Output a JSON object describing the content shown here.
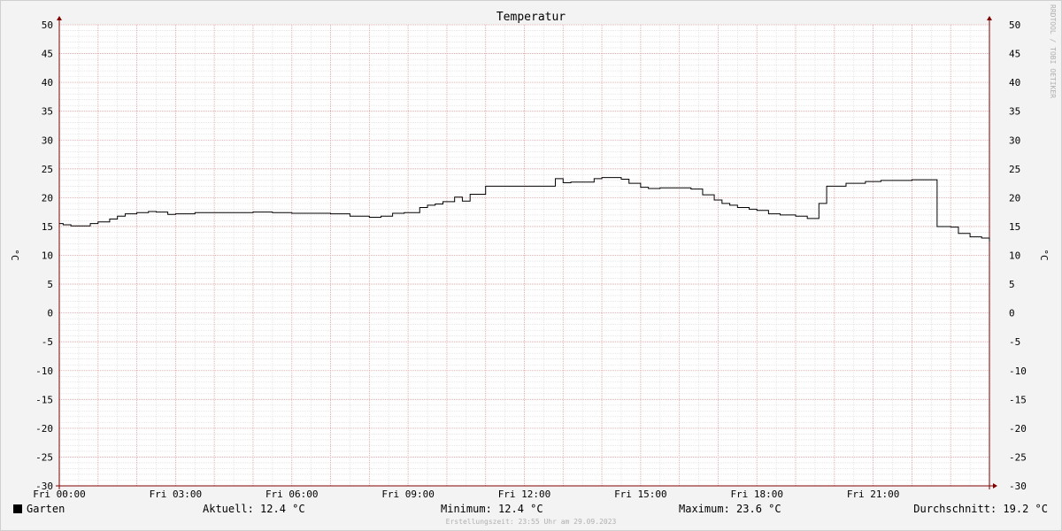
{
  "chart_data": {
    "type": "line",
    "title": "Temperatur",
    "ylabel": "°C",
    "ylim": [
      -30,
      50
    ],
    "yticks": [
      50,
      45,
      40,
      35,
      30,
      25,
      20,
      15,
      10,
      5,
      0,
      -5,
      -10,
      -15,
      -20,
      -25,
      -30
    ],
    "x_range_hours": [
      0,
      24
    ],
    "xticks": [
      {
        "hour": 0,
        "label": "Fri 00:00"
      },
      {
        "hour": 3,
        "label": "Fri 03:00"
      },
      {
        "hour": 6,
        "label": "Fri 06:00"
      },
      {
        "hour": 9,
        "label": "Fri 09:00"
      },
      {
        "hour": 12,
        "label": "Fri 12:00"
      },
      {
        "hour": 15,
        "label": "Fri 15:00"
      },
      {
        "hour": 18,
        "label": "Fri 18:00"
      },
      {
        "hour": 21,
        "label": "Fri 21:00"
      }
    ],
    "grid": true,
    "series": [
      {
        "name": "Garten",
        "color": "#000000",
        "x_hours": [
          0.0,
          0.1,
          0.3,
          0.6,
          0.8,
          1.0,
          1.3,
          1.5,
          1.7,
          2.0,
          2.3,
          2.5,
          2.8,
          3.0,
          3.5,
          4.0,
          4.5,
          5.0,
          5.5,
          6.0,
          6.5,
          7.0,
          7.5,
          8.0,
          8.3,
          8.6,
          8.9,
          9.0,
          9.3,
          9.5,
          9.7,
          9.9,
          10.2,
          10.4,
          10.6,
          11.0,
          11.5,
          12.0,
          12.6,
          12.8,
          13.0,
          13.2,
          13.5,
          13.8,
          14.0,
          14.5,
          14.7,
          15.0,
          15.2,
          15.5,
          15.8,
          16.0,
          16.3,
          16.6,
          16.9,
          17.1,
          17.3,
          17.5,
          17.8,
          18.0,
          18.3,
          18.6,
          19.0,
          19.3,
          19.6,
          19.8,
          19.9,
          20.3,
          20.8,
          21.2,
          21.6,
          22.0,
          22.3,
          22.6,
          22.65,
          23.0,
          23.2,
          23.5,
          23.8,
          24.0
        ],
        "values": [
          15.5,
          15.3,
          15.1,
          15.1,
          15.5,
          15.8,
          16.3,
          16.8,
          17.2,
          17.4,
          17.6,
          17.5,
          17.1,
          17.2,
          17.4,
          17.4,
          17.4,
          17.5,
          17.4,
          17.3,
          17.3,
          17.2,
          16.8,
          16.6,
          16.8,
          17.3,
          17.4,
          17.4,
          18.3,
          18.7,
          18.9,
          19.3,
          20.1,
          19.4,
          20.6,
          22.0,
          22.0,
          22.0,
          22.0,
          23.3,
          22.6,
          22.7,
          22.7,
          23.3,
          23.5,
          23.2,
          22.5,
          21.8,
          21.6,
          21.7,
          21.7,
          21.7,
          21.5,
          20.5,
          19.6,
          19.0,
          18.7,
          18.3,
          18.0,
          17.8,
          17.2,
          17.0,
          16.8,
          16.4,
          19.0,
          22.0,
          22.0,
          22.5,
          22.8,
          23.0,
          23.0,
          23.1,
          23.1,
          23.1,
          15.0,
          14.9,
          13.8,
          13.2,
          13.0,
          12.4
        ]
      }
    ]
  },
  "legend": {
    "series_name": "Garten",
    "current": "Aktuell: 12.4 °C",
    "minimum": "Minimum: 12.4 °C",
    "maximum": "Maximum: 23.6 °C",
    "average": "Durchschnitt: 19.2 °C"
  },
  "footer": "Erstellungszeit: 23:55 Uhr am 29.09.2023",
  "watermark": "RRDTOOL / TOBI OETIKER",
  "colors": {
    "major_grid": "#e6a0a0",
    "minor_grid": "#d8d8d8",
    "axis": "#800000",
    "background": "#f3f3f3",
    "plot_background": "#ffffff",
    "line": "#000000"
  }
}
